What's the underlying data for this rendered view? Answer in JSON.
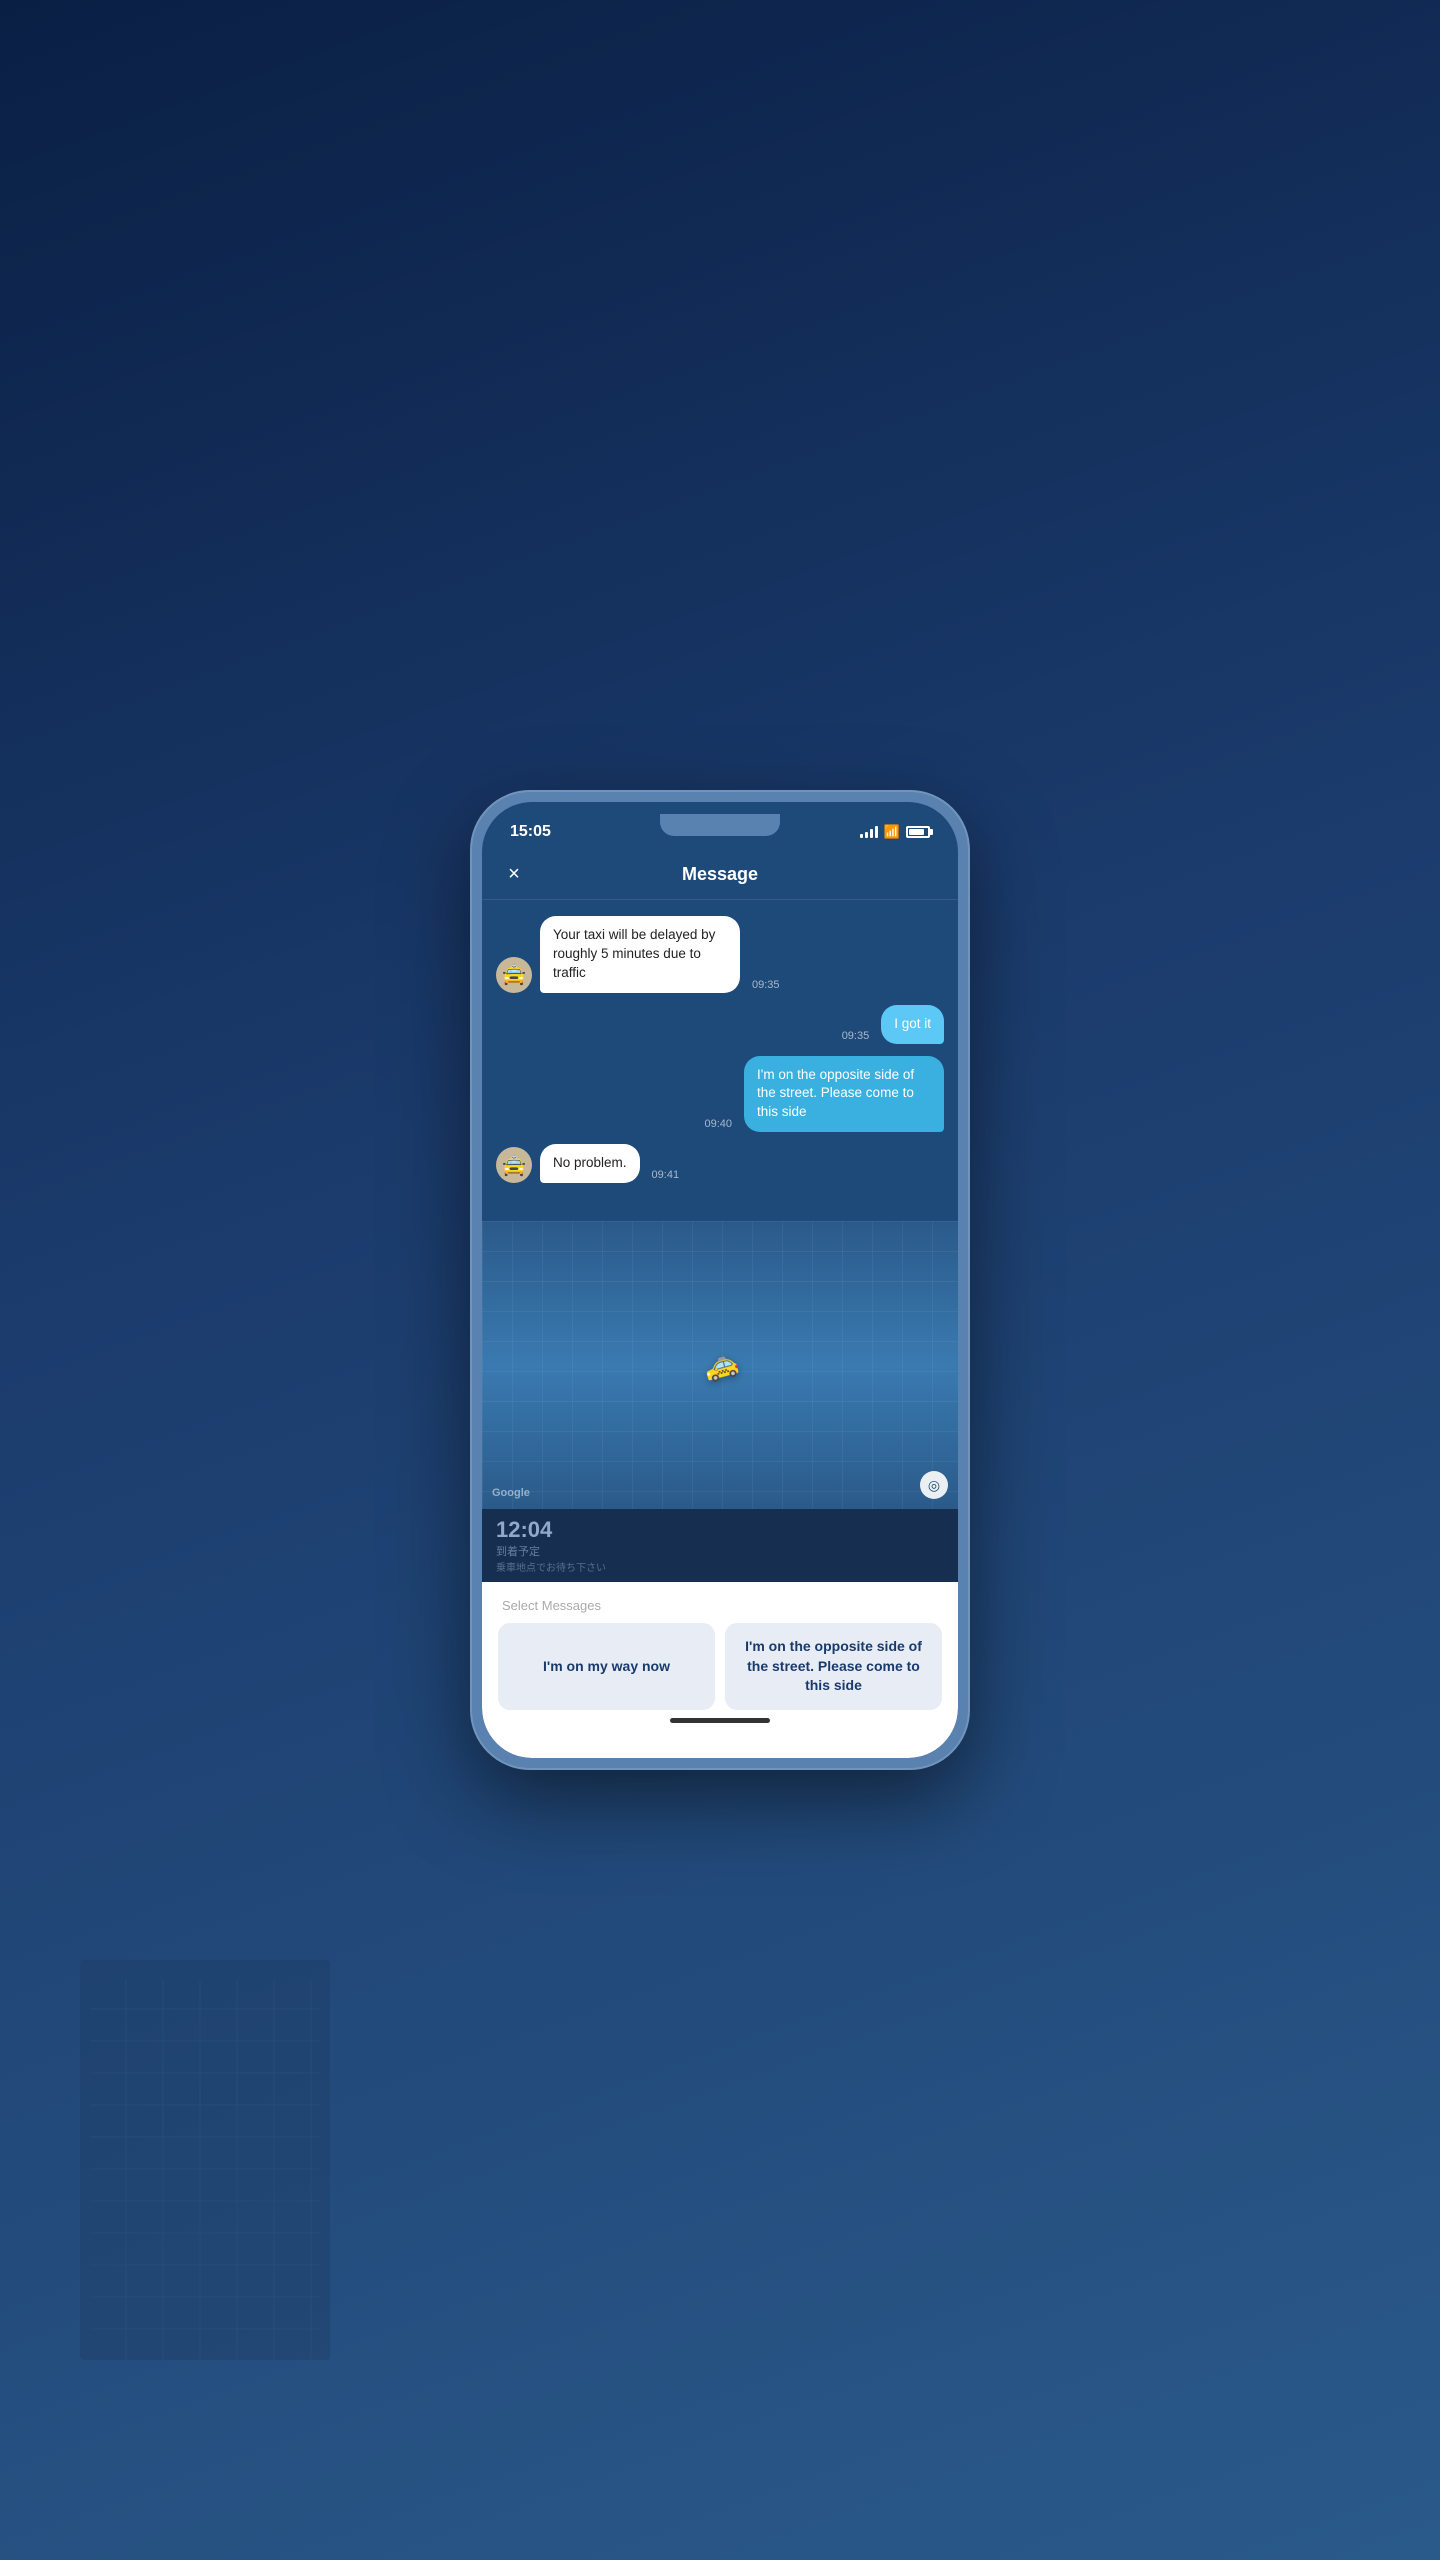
{
  "background": {
    "gradient_start": "#0a1f44",
    "gradient_end": "#2a5a8a"
  },
  "status_bar": {
    "time": "15:05",
    "signal_bars": 4,
    "wifi": true,
    "battery_percent": 85
  },
  "header": {
    "title": "Message",
    "close_label": "×"
  },
  "messages": [
    {
      "id": 1,
      "type": "received",
      "text": "Your taxi will be delayed by roughly 5 minutes due to traffic",
      "time": "09:35",
      "avatar": "🚖"
    },
    {
      "id": 2,
      "type": "sent",
      "text": "I got it",
      "time": "09:35",
      "style": "light"
    },
    {
      "id": 3,
      "type": "sent",
      "text": "I'm on the opposite side of the street. Please come to this side",
      "time": "09:40",
      "style": "dark"
    },
    {
      "id": 4,
      "type": "received",
      "text": "No problem.",
      "time": "09:41",
      "avatar": "🚖"
    }
  ],
  "map": {
    "google_label": "Google",
    "location_icon": "◎"
  },
  "eta": {
    "time": "12:04",
    "label": "到着予定",
    "sublabel": "乗車地点でお待ち下さい"
  },
  "bottom_panel": {
    "label": "Select Messages",
    "quick_replies": [
      {
        "id": 1,
        "text": "I'm on my way now"
      },
      {
        "id": 2,
        "text": "I'm on the opposite side of the street. Please come to this side"
      }
    ]
  }
}
